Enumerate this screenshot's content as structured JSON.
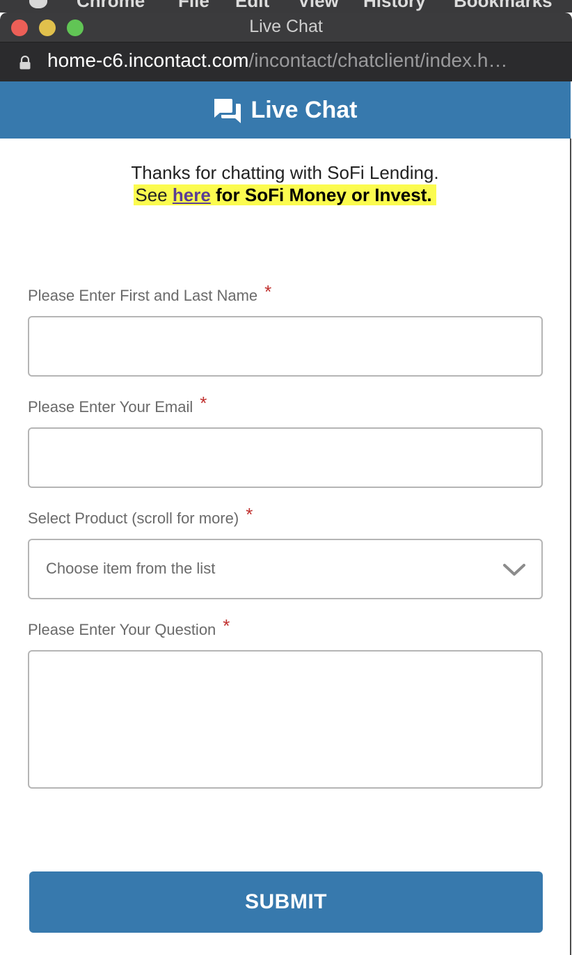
{
  "menubar": {
    "items": [
      "Chrome",
      "File",
      "Edit",
      "View",
      "History",
      "Bookmarks"
    ]
  },
  "window": {
    "title": "Live Chat"
  },
  "address_bar": {
    "domain": "home-c6.incontact.com",
    "path": "/incontact/chatclient/index.h…"
  },
  "header": {
    "icon": "chat-bubbles-icon",
    "title": "Live Chat"
  },
  "intro": {
    "line1": "Thanks for chatting with SoFi Lending.",
    "line2_prefix": "See ",
    "line2_link": "here",
    "line2_suffix": " for SoFi Money or Invest.",
    "highlight_color": "#fbfb4f"
  },
  "form": {
    "name_label": "Please Enter First and Last Name",
    "name_value": "",
    "email_label": "Please Enter Your Email",
    "email_value": "",
    "product_label": "Select Product (scroll for more)",
    "product_selected": "Choose item from the list",
    "question_label": "Please Enter Your Question",
    "question_value": "",
    "required_marker": "*",
    "submit_label": "SUBMIT"
  },
  "colors": {
    "brand": "#3779ad",
    "required": "#c0302e",
    "link": "#5b3d94"
  }
}
